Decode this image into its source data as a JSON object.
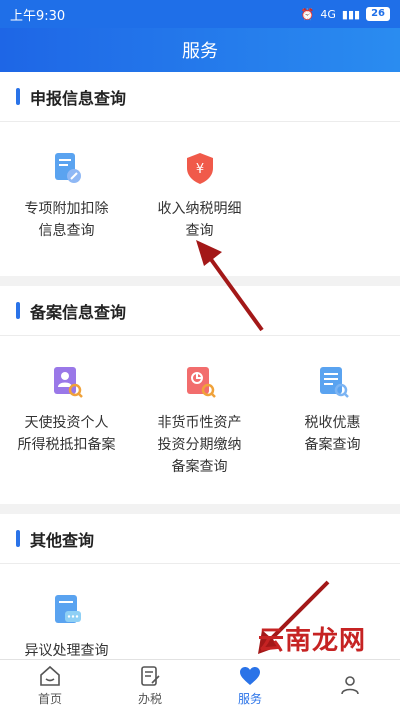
{
  "status": {
    "time": "上午9:30",
    "net": "4G",
    "battery": "26"
  },
  "header": {
    "title": "服务"
  },
  "sections": [
    {
      "title": "申报信息查询",
      "items": [
        {
          "line1": "专项附加扣除",
          "line2": "信息查询",
          "icon": "document-edit-icon"
        },
        {
          "line1": "收入纳税明细",
          "line2": "查询",
          "icon": "yuan-shield-icon"
        }
      ]
    },
    {
      "title": "备案信息查询",
      "items": [
        {
          "line1": "天使投资个人",
          "line2": "所得税抵扣备案",
          "line3": "",
          "icon": "person-search-icon"
        },
        {
          "line1": "非货币性资产",
          "line2": "投资分期缴纳",
          "line3": "备案查询",
          "icon": "chart-search-icon"
        },
        {
          "line1": "税收优惠",
          "line2": "备案查询",
          "line3": "",
          "icon": "list-search-icon"
        }
      ]
    },
    {
      "title": "其他查询",
      "items": [
        {
          "line1": "异议处理查询",
          "icon": "message-document-icon"
        }
      ]
    }
  ],
  "tabs": [
    {
      "label": "首页",
      "icon": "home-icon"
    },
    {
      "label": "办税",
      "icon": "form-icon"
    },
    {
      "label": "服务",
      "icon": "heart-icon"
    },
    {
      "label": "",
      "icon": "person-icon"
    }
  ],
  "watermark": "云南龙网",
  "colors": {
    "primary": "#2a73e8",
    "arrow": "#a31818"
  }
}
